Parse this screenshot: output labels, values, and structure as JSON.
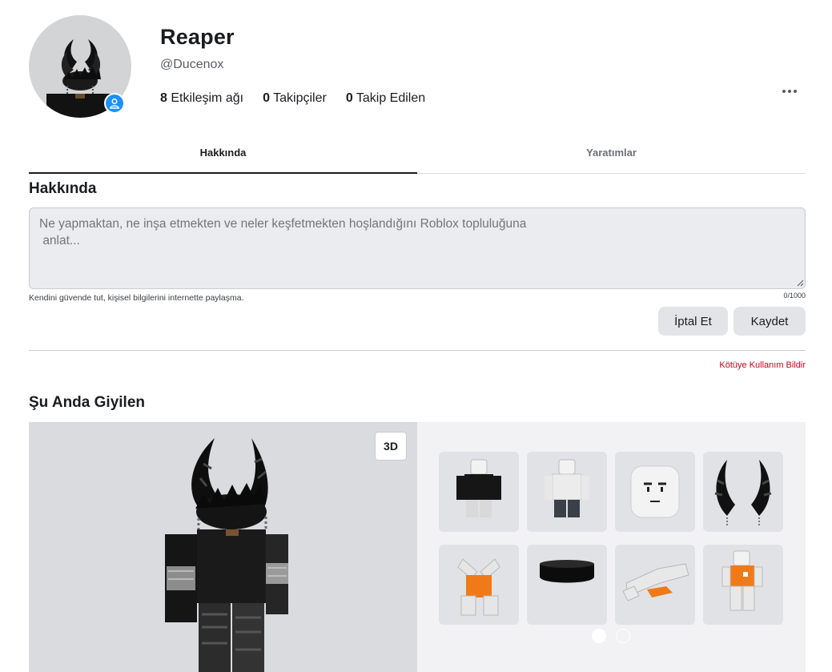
{
  "profile": {
    "display_name": "Reaper",
    "username": "@Ducenox",
    "stats": [
      {
        "count": "8",
        "label": "Etkileşim ağı"
      },
      {
        "count": "0",
        "label": "Takipçiler"
      },
      {
        "count": "0",
        "label": "Takip Edilen"
      }
    ]
  },
  "tabs": [
    {
      "label": "Hakkında",
      "active": true
    },
    {
      "label": "Yaratımlar",
      "active": false
    }
  ],
  "about": {
    "heading": "Hakkında",
    "placeholder": "Ne yapmaktan, ne inşa etmekten ve neler keşfetmekten hoşlandığını Roblox topluluğuna\n anlat...",
    "safety_note": "Kendini güvende tut, kişisel bilgilerini internette paylaşma.",
    "char_count": "0/1000",
    "cancel_label": "İptal Et",
    "save_label": "Kaydet",
    "report_label": "Kötüye Kullanım Bildir"
  },
  "wearing": {
    "heading": "Şu Anda Giyilen",
    "view_mode_label": "3D",
    "items": [
      {
        "name": "black-shirt"
      },
      {
        "name": "white-shirt"
      },
      {
        "name": "face"
      },
      {
        "name": "dark-horns"
      },
      {
        "name": "orange-torso-part"
      },
      {
        "name": "black-hat"
      },
      {
        "name": "orange-leg-part"
      },
      {
        "name": "orange-character"
      }
    ],
    "page_count": 2,
    "current_page": 1
  },
  "colors": {
    "accent_blue": "#1e90ff",
    "report_red": "#d0021b",
    "panel_gray": "#dadbdf"
  }
}
